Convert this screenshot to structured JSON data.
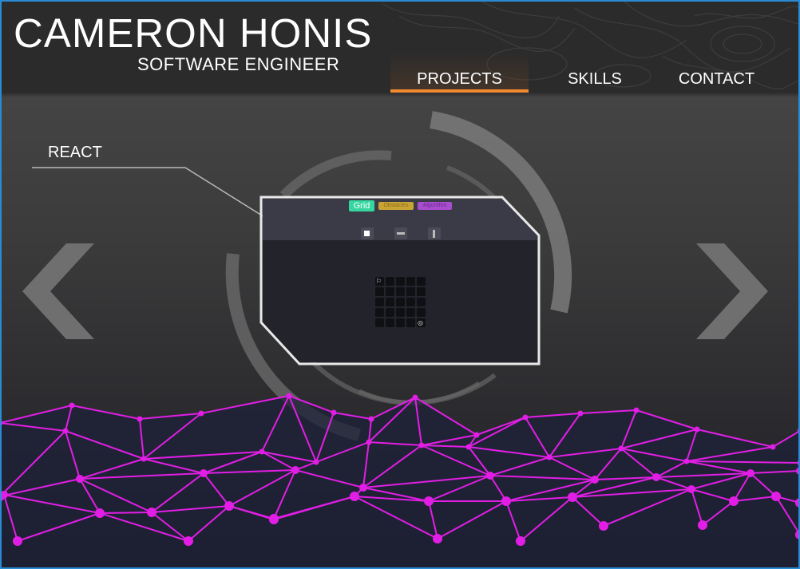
{
  "header": {
    "name": "CAMERON HONIS",
    "role": "SOFTWARE ENGINEER",
    "nav": [
      {
        "label": "PROJECTS",
        "active": true
      },
      {
        "label": "SKILLS",
        "active": false
      },
      {
        "label": "CONTACT",
        "active": false
      }
    ]
  },
  "carousel": {
    "project_label": "REACT",
    "prev_icon": "chevron-left-icon",
    "next_icon": "chevron-right-icon"
  },
  "preview": {
    "tabs": [
      "Grid",
      "Obstacles",
      "Algorithm"
    ],
    "tools": [
      "square-tool-icon",
      "row-tool-icon",
      "column-tool-icon"
    ],
    "grid": {
      "rows": 5,
      "cols": 5,
      "start_marker": "⚐",
      "end_marker": "◎"
    }
  },
  "colors": {
    "accent": "#f08a2e",
    "mesh": "#e21ee6",
    "tab_grid": "#35d6a0",
    "tab_obstacles": "#c9a435",
    "tab_algorithm": "#a84cd0"
  }
}
